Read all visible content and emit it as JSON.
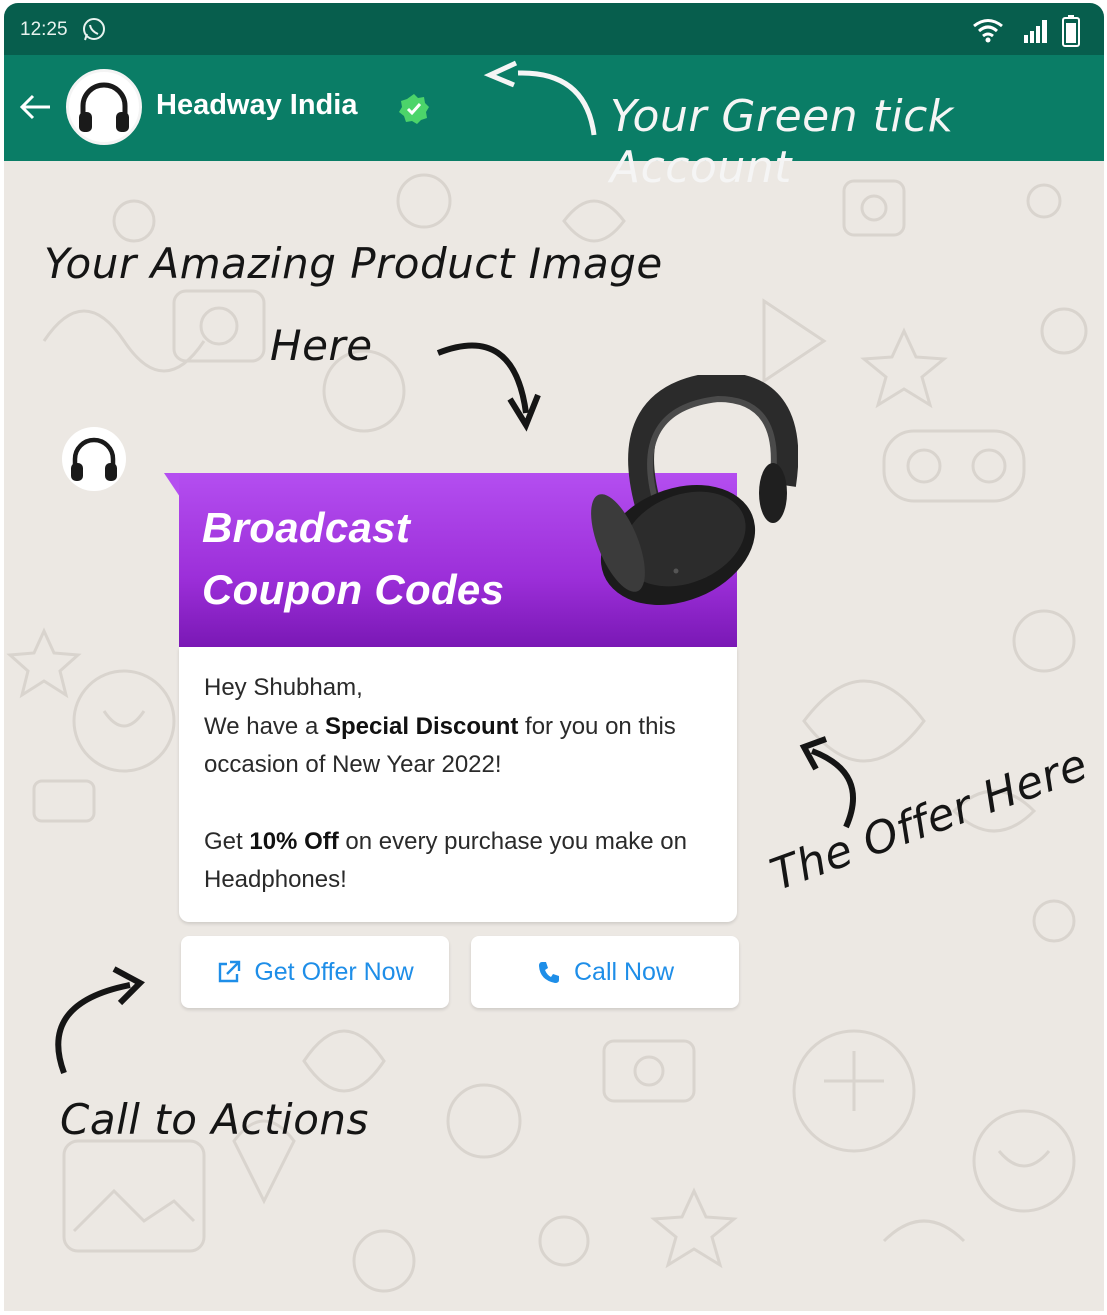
{
  "status_bar": {
    "time": "12:25"
  },
  "header": {
    "contact_name": "Headway India"
  },
  "annotations": {
    "green_tick": "Your Green tick Account",
    "product_image_line1": "Your Amazing Product Image",
    "product_image_line2": "Here",
    "offer": "The Offer Here",
    "cta": "Call to Actions"
  },
  "message": {
    "banner_line1": "Broadcast",
    "banner_line2": "Coupon Codes",
    "greeting": "Hey Shubham,",
    "line2_pre": "We have a ",
    "line2_bold": "Special Discount",
    "line2_post": " for you on this occasion of New Year 2022!",
    "offer_pre": "Get ",
    "offer_bold": "10% Off",
    "offer_post": " on every purchase you make on Headphones!"
  },
  "buttons": {
    "get_offer": "Get Offer Now",
    "call_now": "Call Now"
  },
  "colors": {
    "status_bar": "#075e4d",
    "header": "#0a7d66",
    "banner": "#a63ae4",
    "button_text": "#1e8ee8",
    "verified": "#4cd46a"
  }
}
